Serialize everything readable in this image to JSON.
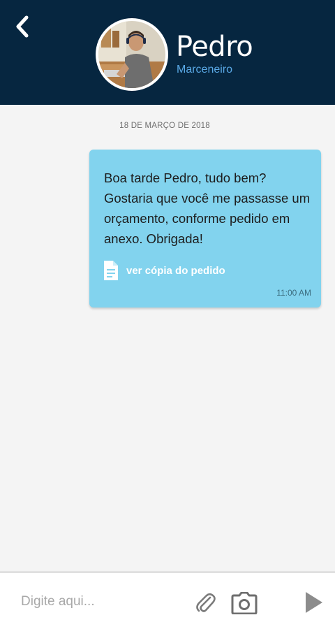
{
  "header": {
    "contact_name": "Pedro",
    "contact_role": "Marceneiro",
    "background": "#062640",
    "role_color": "#5aa9e6"
  },
  "conversation": {
    "date_label": "18 DE MARÇO DE 2018",
    "messages": [
      {
        "text": "Boa tarde Pedro, tudo bem? Gostaria que você me passasse um orçamento, conforme pedido em anexo. Obrigada!",
        "attachment_label": "ver cópia do pedido",
        "time": "11:00 AM",
        "bubble_color": "#82d3ee"
      }
    ]
  },
  "composer": {
    "placeholder": "Digite aqui...",
    "value": ""
  },
  "icons": {
    "back": "chevron-left-icon",
    "attachment": "document-icon",
    "clip": "paperclip-icon",
    "camera": "camera-icon",
    "send": "play-send-icon"
  }
}
